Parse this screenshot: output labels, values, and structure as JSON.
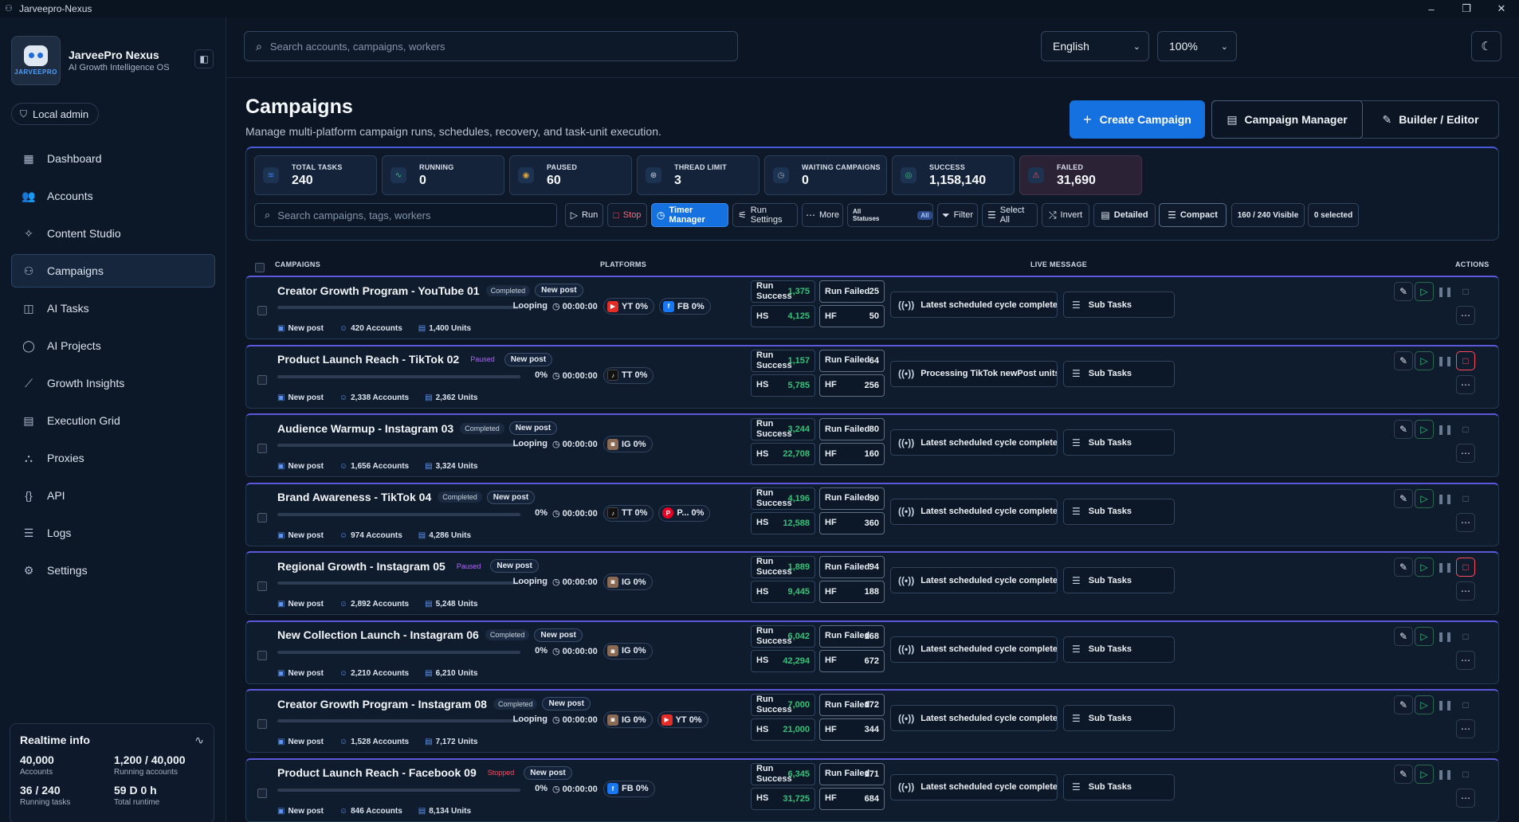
{
  "window": {
    "title": "Jarveepro-Nexus"
  },
  "brand": {
    "title": "JarveePro Nexus",
    "subtitle": "AI Growth Intelligence OS",
    "logo_text": "JARVEEPRO"
  },
  "role": "Local admin",
  "nav": [
    {
      "label": "Dashboard",
      "icon": "grid-icon",
      "glyph": "▦"
    },
    {
      "label": "Accounts",
      "icon": "users-icon",
      "glyph": "👥"
    },
    {
      "label": "Content Studio",
      "icon": "sparkle-icon",
      "glyph": "✧"
    },
    {
      "label": "Campaigns",
      "icon": "campaign-icon",
      "glyph": "⚇",
      "active": true
    },
    {
      "label": "AI Tasks",
      "icon": "robot-icon",
      "glyph": "◫"
    },
    {
      "label": "AI Projects",
      "icon": "chat-icon",
      "glyph": "◯"
    },
    {
      "label": "Growth Insights",
      "icon": "chart-icon",
      "glyph": "⟋"
    },
    {
      "label": "Execution Grid",
      "icon": "table-icon",
      "glyph": "▤"
    },
    {
      "label": "Proxies",
      "icon": "network-icon",
      "glyph": "⛬"
    },
    {
      "label": "API",
      "icon": "braces-icon",
      "glyph": "{}"
    },
    {
      "label": "Logs",
      "icon": "list-icon",
      "glyph": "☰"
    },
    {
      "label": "Settings",
      "icon": "gear-icon",
      "glyph": "⚙"
    }
  ],
  "realtime": {
    "title": "Realtime info",
    "items": [
      {
        "value": "40,000",
        "label": "Accounts"
      },
      {
        "value": "1,200 / 40,000",
        "label": "Running accounts"
      },
      {
        "value": "36 / 240",
        "label": "Running tasks"
      },
      {
        "value": "59 D 0 h",
        "label": "Total runtime"
      }
    ]
  },
  "top": {
    "search_placeholder": "Search accounts, campaigns, workers",
    "language": "English",
    "zoom": "100%"
  },
  "header": {
    "title": "Campaigns",
    "subtitle": "Manage multi-platform campaign runs, schedules, recovery, and task-unit execution.",
    "create_label": "Create Campaign",
    "manager_label": "Campaign Manager",
    "builder_label": "Builder / Editor"
  },
  "stats": [
    {
      "label": "TOTAL TASKS",
      "value": "240",
      "color": "#3b7df0"
    },
    {
      "label": "RUNNING",
      "value": "0",
      "color": "#37c27a"
    },
    {
      "label": "PAUSED",
      "value": "60",
      "color": "#e3a53a"
    },
    {
      "label": "THREAD LIMIT",
      "value": "3",
      "color": "#cfd6e2"
    },
    {
      "label": "WAITING CAMPAIGNS",
      "value": "0",
      "color": "#9aa8bb"
    },
    {
      "label": "SUCCESS",
      "value": "1,158,140",
      "color": "#37c27a"
    },
    {
      "label": "FAILED",
      "value": "31,690",
      "color": "#ff4b5c"
    }
  ],
  "toolbar": {
    "search_placeholder": "Search campaigns, tags, workers",
    "run": "Run",
    "stop": "Stop",
    "timer_manager": "Timer Manager",
    "run_settings": "Run Settings",
    "more": "More",
    "status_filter": "All Statuses",
    "status_badge": "All",
    "filter": "Filter",
    "select_all": "Select All",
    "invert": "Invert",
    "detailed": "Detailed",
    "compact": "Compact",
    "visible": "160 / 240 Visible",
    "selected": "0 selected"
  },
  "table_headers": {
    "campaigns": "CAMPAIGNS",
    "platforms": "PLATFORMS",
    "live": "LIVE MESSAGE",
    "actions": "ACTIONS"
  },
  "labels": {
    "run_success_1": "Run",
    "run_success_2": "Success",
    "hs": "HS",
    "run_failed": "Run Failed",
    "hf": "HF",
    "sub_tasks": "Sub Tasks",
    "new_post": "New post"
  },
  "campaigns": [
    {
      "name": "Creator Growth Program - YouTube 01",
      "status": "Completed",
      "status_class": "completed",
      "tag": "New post",
      "progress": "Looping",
      "timer": "00:00:00",
      "platforms": [
        {
          "code": "yt",
          "label": "YT 0%",
          "glyph": "▶"
        },
        {
          "code": "fb",
          "label": "FB 0%",
          "glyph": "f"
        }
      ],
      "type": "New post",
      "accounts": "420 Accounts",
      "units": "1,400 Units",
      "run_success": "1,375",
      "hs": "4,125",
      "run_failed": "25",
      "hf": "50",
      "live": "Latest scheduled cycle completed",
      "stop_active": false
    },
    {
      "name": "Product Launch Reach - TikTok 02",
      "status": "Paused",
      "status_class": "paused",
      "tag": "New post",
      "progress": "0%",
      "timer": "00:00:00",
      "platforms": [
        {
          "code": "tt",
          "label": "TT 0%",
          "glyph": "♪"
        }
      ],
      "type": "New post",
      "accounts": "2,338 Accounts",
      "units": "2,362 Units",
      "run_success": "1,157",
      "hs": "5,785",
      "run_failed": "64",
      "hf": "256",
      "live": "Processing TikTok newPost units",
      "stop_active": true
    },
    {
      "name": "Audience Warmup - Instagram 03",
      "status": "Completed",
      "status_class": "completed",
      "tag": "New post",
      "progress": "Looping",
      "timer": "00:00:00",
      "platforms": [
        {
          "code": "ig",
          "label": "IG 0%",
          "glyph": "◙"
        }
      ],
      "type": "New post",
      "accounts": "1,656 Accounts",
      "units": "3,324 Units",
      "run_success": "3,244",
      "hs": "22,708",
      "run_failed": "80",
      "hf": "160",
      "live": "Latest scheduled cycle completed",
      "stop_active": false
    },
    {
      "name": "Brand Awareness - TikTok 04",
      "status": "Completed",
      "status_class": "completed",
      "tag": "New post",
      "progress": "0%",
      "timer": "00:00:00",
      "platforms": [
        {
          "code": "tt",
          "label": "TT 0%",
          "glyph": "♪"
        },
        {
          "code": "p",
          "label": "P... 0%",
          "glyph": "P"
        }
      ],
      "type": "New post",
      "accounts": "974 Accounts",
      "units": "4,286 Units",
      "run_success": "4,196",
      "hs": "12,588",
      "run_failed": "90",
      "hf": "360",
      "live": "Latest scheduled cycle completed",
      "stop_active": false
    },
    {
      "name": "Regional Growth - Instagram 05",
      "status": "Paused",
      "status_class": "paused",
      "tag": "New post",
      "progress": "Looping",
      "timer": "00:00:00",
      "platforms": [
        {
          "code": "ig",
          "label": "IG 0%",
          "glyph": "◙"
        }
      ],
      "type": "New post",
      "accounts": "2,892 Accounts",
      "units": "5,248 Units",
      "run_success": "1,889",
      "hs": "9,445",
      "run_failed": "94",
      "hf": "188",
      "live": "Latest scheduled cycle completed",
      "stop_active": true
    },
    {
      "name": "New Collection Launch - Instagram 06",
      "status": "Completed",
      "status_class": "completed",
      "tag": "New post",
      "progress": "0%",
      "timer": "00:00:00",
      "platforms": [
        {
          "code": "ig",
          "label": "IG 0%",
          "glyph": "◙"
        }
      ],
      "type": "New post",
      "accounts": "2,210 Accounts",
      "units": "6,210 Units",
      "run_success": "6,042",
      "hs": "42,294",
      "run_failed": "168",
      "hf": "672",
      "live": "Latest scheduled cycle completed",
      "stop_active": false
    },
    {
      "name": "Creator Growth Program - Instagram 08",
      "status": "Completed",
      "status_class": "completed",
      "tag": "New post",
      "progress": "Looping",
      "timer": "00:00:00",
      "platforms": [
        {
          "code": "ig",
          "label": "IG 0%",
          "glyph": "◙"
        },
        {
          "code": "yt",
          "label": "YT 0%",
          "glyph": "▶"
        }
      ],
      "type": "New post",
      "accounts": "1,528 Accounts",
      "units": "7,172 Units",
      "run_success": "7,000",
      "hs": "21,000",
      "run_failed": "172",
      "hf": "344",
      "live": "Latest scheduled cycle completed",
      "stop_active": false
    },
    {
      "name": "Product Launch Reach - Facebook 09",
      "status": "Stopped",
      "status_class": "stopped",
      "tag": "New post",
      "progress": "0%",
      "timer": "00:00:00",
      "platforms": [
        {
          "code": "fb",
          "label": "FB 0%",
          "glyph": "f"
        }
      ],
      "type": "New post",
      "accounts": "846 Accounts",
      "units": "8,134 Units",
      "run_success": "6,345",
      "hs": "31,725",
      "run_failed": "171",
      "hf": "684",
      "live": "Latest scheduled cycle completed",
      "stop_active": false
    }
  ]
}
